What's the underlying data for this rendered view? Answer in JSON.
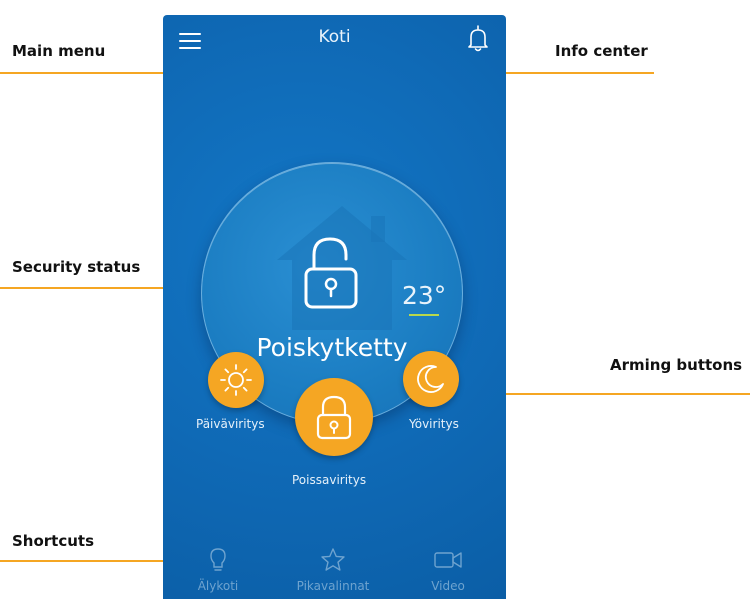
{
  "callouts": {
    "main_menu": "Main menu",
    "info_center": "Info center",
    "security_status": "Security status",
    "arming_buttons": "Arming buttons",
    "shortcuts": "Shortcuts"
  },
  "header": {
    "title": "Koti"
  },
  "status": {
    "text": "Poiskytketty",
    "temperature": "23°"
  },
  "arming": {
    "day_label": "Päiväviritys",
    "away_label": "Poissaviritys",
    "night_label": "Yöviritys"
  },
  "nav": {
    "items": [
      {
        "label": "Älykoti",
        "icon": "lightbulb-icon"
      },
      {
        "label": "Pikavalinnat",
        "icon": "star-icon"
      },
      {
        "label": "Video",
        "icon": "video-camera-icon"
      }
    ]
  },
  "colors": {
    "accent": "#f5a623",
    "screen_bg": "#0f69b5",
    "temp_underline": "#b9d84c"
  }
}
